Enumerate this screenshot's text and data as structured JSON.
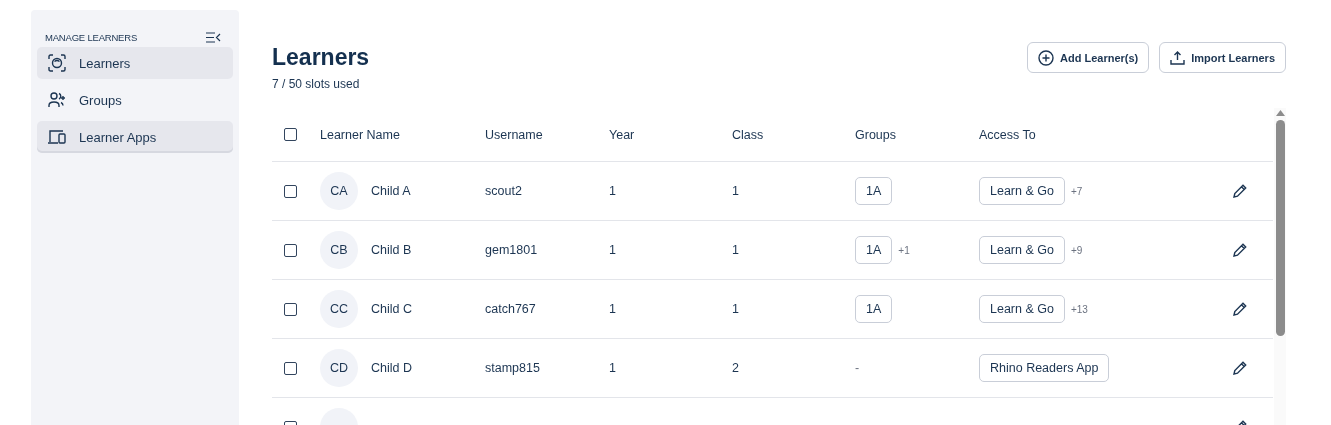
{
  "sidebar": {
    "heading": "MANAGE LEARNERS",
    "items": [
      {
        "label": "Learners",
        "kind": "face",
        "selected": true,
        "hovered": false
      },
      {
        "label": "Groups",
        "kind": "people",
        "selected": false,
        "hovered": false
      },
      {
        "label": "Learner Apps",
        "kind": "devices",
        "selected": false,
        "hovered": true
      }
    ]
  },
  "page": {
    "title": "Learners",
    "subtitle": "7 / 50 slots used"
  },
  "actions": [
    {
      "label": "Add Learner(s)",
      "kind": "plus"
    },
    {
      "label": "Import Learners",
      "kind": "upload"
    }
  ],
  "table": {
    "header_checked": false,
    "columns": [
      "Learner Name",
      "Username",
      "Year",
      "Class",
      "Groups",
      "Access To"
    ],
    "rows": [
      {
        "checked": false,
        "initials": "CA",
        "name": "Child A",
        "username": "scout2",
        "year": "1",
        "class": "1",
        "groups": [
          "1A"
        ],
        "groups_more": null,
        "groups_empty": null,
        "access": "Learn & Go",
        "access_more": "+7"
      },
      {
        "checked": false,
        "initials": "CB",
        "name": "Child B",
        "username": "gem1801",
        "year": "1",
        "class": "1",
        "groups": [
          "1A"
        ],
        "groups_more": "+1",
        "groups_empty": null,
        "access": "Learn & Go",
        "access_more": "+9"
      },
      {
        "checked": false,
        "initials": "CC",
        "name": "Child C",
        "username": "catch767",
        "year": "1",
        "class": "1",
        "groups": [
          "1A"
        ],
        "groups_more": null,
        "groups_empty": null,
        "access": "Learn & Go",
        "access_more": "+13"
      },
      {
        "checked": false,
        "initials": "CD",
        "name": "Child D",
        "username": "stamp815",
        "year": "1",
        "class": "2",
        "groups": [],
        "groups_more": null,
        "groups_empty": "-",
        "access": "Rhino Readers App",
        "access_more": null
      },
      {
        "checked": false
      }
    ]
  }
}
